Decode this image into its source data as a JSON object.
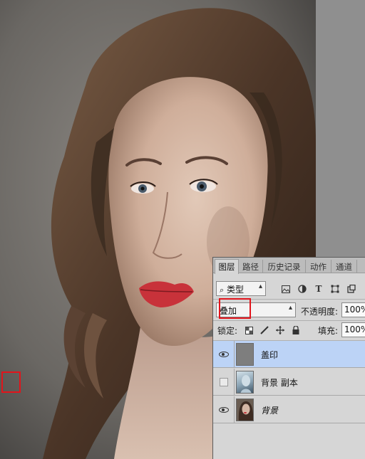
{
  "panel": {
    "tabs": [
      {
        "label": "图层",
        "active": true
      },
      {
        "label": "路径",
        "active": false
      },
      {
        "label": "历史记录",
        "active": false
      },
      {
        "label": "动作",
        "active": false
      },
      {
        "label": "通道",
        "active": false
      }
    ],
    "filter": {
      "icon": "search-icon",
      "label": "类型"
    },
    "blend_mode": "叠加",
    "opacity_label": "不透明度:",
    "opacity_value": "100%",
    "lock_label": "锁定:",
    "fill_label": "填充:",
    "fill_value": "100%",
    "layers": [
      {
        "name": "盖印",
        "visible": true,
        "selected": true,
        "italic": false
      },
      {
        "name": "背景 副本",
        "visible": false,
        "selected": false,
        "italic": false
      },
      {
        "name": "背景",
        "visible": true,
        "selected": false,
        "italic": true
      }
    ]
  },
  "colors": {
    "highlight": "#e2141b",
    "selected_row": "#bcd3f6",
    "panel_bg": "#d6d6d6",
    "canvas_bg": "#8f8f8f"
  }
}
